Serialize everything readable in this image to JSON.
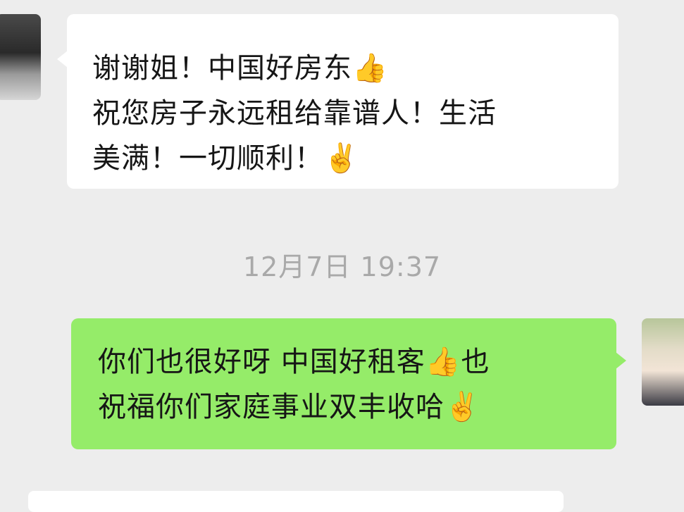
{
  "messages": {
    "incoming": {
      "lines": [
        "谢谢姐！中国好房东👍",
        "祝您房子永远租给靠谱人！生活",
        "美满！一切顺利！✌️"
      ]
    },
    "timestamp": "12月7日 19:37",
    "outgoing": {
      "lines": [
        "你们也很好呀 中国好租客👍也",
        "祝福你们家庭事业双丰收哈✌️"
      ]
    }
  },
  "colors": {
    "background": "#ededed",
    "incoming_bubble": "#ffffff",
    "outgoing_bubble": "#95ec69",
    "timestamp_text": "#a9a9a9"
  }
}
